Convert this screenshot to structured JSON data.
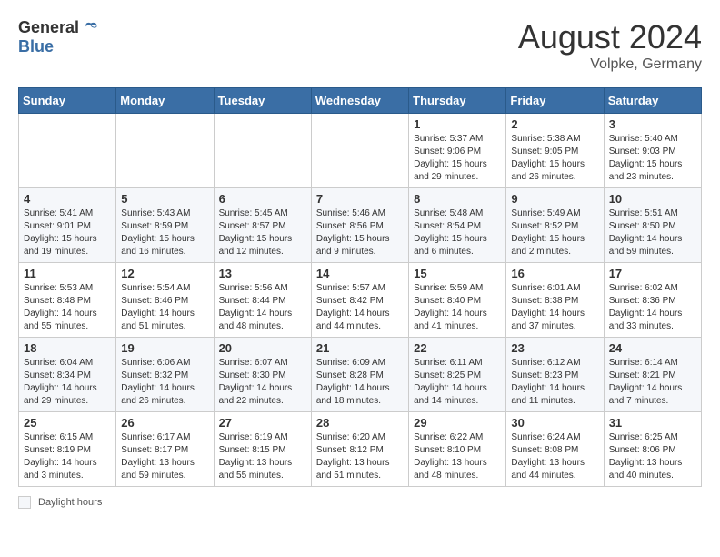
{
  "header": {
    "logo_general": "General",
    "logo_blue": "Blue",
    "month_year": "August 2024",
    "location": "Volpke, Germany"
  },
  "calendar": {
    "days_of_week": [
      "Sunday",
      "Monday",
      "Tuesday",
      "Wednesday",
      "Thursday",
      "Friday",
      "Saturday"
    ],
    "weeks": [
      [
        {
          "day": "",
          "info": ""
        },
        {
          "day": "",
          "info": ""
        },
        {
          "day": "",
          "info": ""
        },
        {
          "day": "",
          "info": ""
        },
        {
          "day": "1",
          "info": "Sunrise: 5:37 AM\nSunset: 9:06 PM\nDaylight: 15 hours\nand 29 minutes."
        },
        {
          "day": "2",
          "info": "Sunrise: 5:38 AM\nSunset: 9:05 PM\nDaylight: 15 hours\nand 26 minutes."
        },
        {
          "day": "3",
          "info": "Sunrise: 5:40 AM\nSunset: 9:03 PM\nDaylight: 15 hours\nand 23 minutes."
        }
      ],
      [
        {
          "day": "4",
          "info": "Sunrise: 5:41 AM\nSunset: 9:01 PM\nDaylight: 15 hours\nand 19 minutes."
        },
        {
          "day": "5",
          "info": "Sunrise: 5:43 AM\nSunset: 8:59 PM\nDaylight: 15 hours\nand 16 minutes."
        },
        {
          "day": "6",
          "info": "Sunrise: 5:45 AM\nSunset: 8:57 PM\nDaylight: 15 hours\nand 12 minutes."
        },
        {
          "day": "7",
          "info": "Sunrise: 5:46 AM\nSunset: 8:56 PM\nDaylight: 15 hours\nand 9 minutes."
        },
        {
          "day": "8",
          "info": "Sunrise: 5:48 AM\nSunset: 8:54 PM\nDaylight: 15 hours\nand 6 minutes."
        },
        {
          "day": "9",
          "info": "Sunrise: 5:49 AM\nSunset: 8:52 PM\nDaylight: 15 hours\nand 2 minutes."
        },
        {
          "day": "10",
          "info": "Sunrise: 5:51 AM\nSunset: 8:50 PM\nDaylight: 14 hours\nand 59 minutes."
        }
      ],
      [
        {
          "day": "11",
          "info": "Sunrise: 5:53 AM\nSunset: 8:48 PM\nDaylight: 14 hours\nand 55 minutes."
        },
        {
          "day": "12",
          "info": "Sunrise: 5:54 AM\nSunset: 8:46 PM\nDaylight: 14 hours\nand 51 minutes."
        },
        {
          "day": "13",
          "info": "Sunrise: 5:56 AM\nSunset: 8:44 PM\nDaylight: 14 hours\nand 48 minutes."
        },
        {
          "day": "14",
          "info": "Sunrise: 5:57 AM\nSunset: 8:42 PM\nDaylight: 14 hours\nand 44 minutes."
        },
        {
          "day": "15",
          "info": "Sunrise: 5:59 AM\nSunset: 8:40 PM\nDaylight: 14 hours\nand 41 minutes."
        },
        {
          "day": "16",
          "info": "Sunrise: 6:01 AM\nSunset: 8:38 PM\nDaylight: 14 hours\nand 37 minutes."
        },
        {
          "day": "17",
          "info": "Sunrise: 6:02 AM\nSunset: 8:36 PM\nDaylight: 14 hours\nand 33 minutes."
        }
      ],
      [
        {
          "day": "18",
          "info": "Sunrise: 6:04 AM\nSunset: 8:34 PM\nDaylight: 14 hours\nand 29 minutes."
        },
        {
          "day": "19",
          "info": "Sunrise: 6:06 AM\nSunset: 8:32 PM\nDaylight: 14 hours\nand 26 minutes."
        },
        {
          "day": "20",
          "info": "Sunrise: 6:07 AM\nSunset: 8:30 PM\nDaylight: 14 hours\nand 22 minutes."
        },
        {
          "day": "21",
          "info": "Sunrise: 6:09 AM\nSunset: 8:28 PM\nDaylight: 14 hours\nand 18 minutes."
        },
        {
          "day": "22",
          "info": "Sunrise: 6:11 AM\nSunset: 8:25 PM\nDaylight: 14 hours\nand 14 minutes."
        },
        {
          "day": "23",
          "info": "Sunrise: 6:12 AM\nSunset: 8:23 PM\nDaylight: 14 hours\nand 11 minutes."
        },
        {
          "day": "24",
          "info": "Sunrise: 6:14 AM\nSunset: 8:21 PM\nDaylight: 14 hours\nand 7 minutes."
        }
      ],
      [
        {
          "day": "25",
          "info": "Sunrise: 6:15 AM\nSunset: 8:19 PM\nDaylight: 14 hours\nand 3 minutes."
        },
        {
          "day": "26",
          "info": "Sunrise: 6:17 AM\nSunset: 8:17 PM\nDaylight: 13 hours\nand 59 minutes."
        },
        {
          "day": "27",
          "info": "Sunrise: 6:19 AM\nSunset: 8:15 PM\nDaylight: 13 hours\nand 55 minutes."
        },
        {
          "day": "28",
          "info": "Sunrise: 6:20 AM\nSunset: 8:12 PM\nDaylight: 13 hours\nand 51 minutes."
        },
        {
          "day": "29",
          "info": "Sunrise: 6:22 AM\nSunset: 8:10 PM\nDaylight: 13 hours\nand 48 minutes."
        },
        {
          "day": "30",
          "info": "Sunrise: 6:24 AM\nSunset: 8:08 PM\nDaylight: 13 hours\nand 44 minutes."
        },
        {
          "day": "31",
          "info": "Sunrise: 6:25 AM\nSunset: 8:06 PM\nDaylight: 13 hours\nand 40 minutes."
        }
      ]
    ]
  },
  "footer": {
    "daylight_label": "Daylight hours"
  }
}
